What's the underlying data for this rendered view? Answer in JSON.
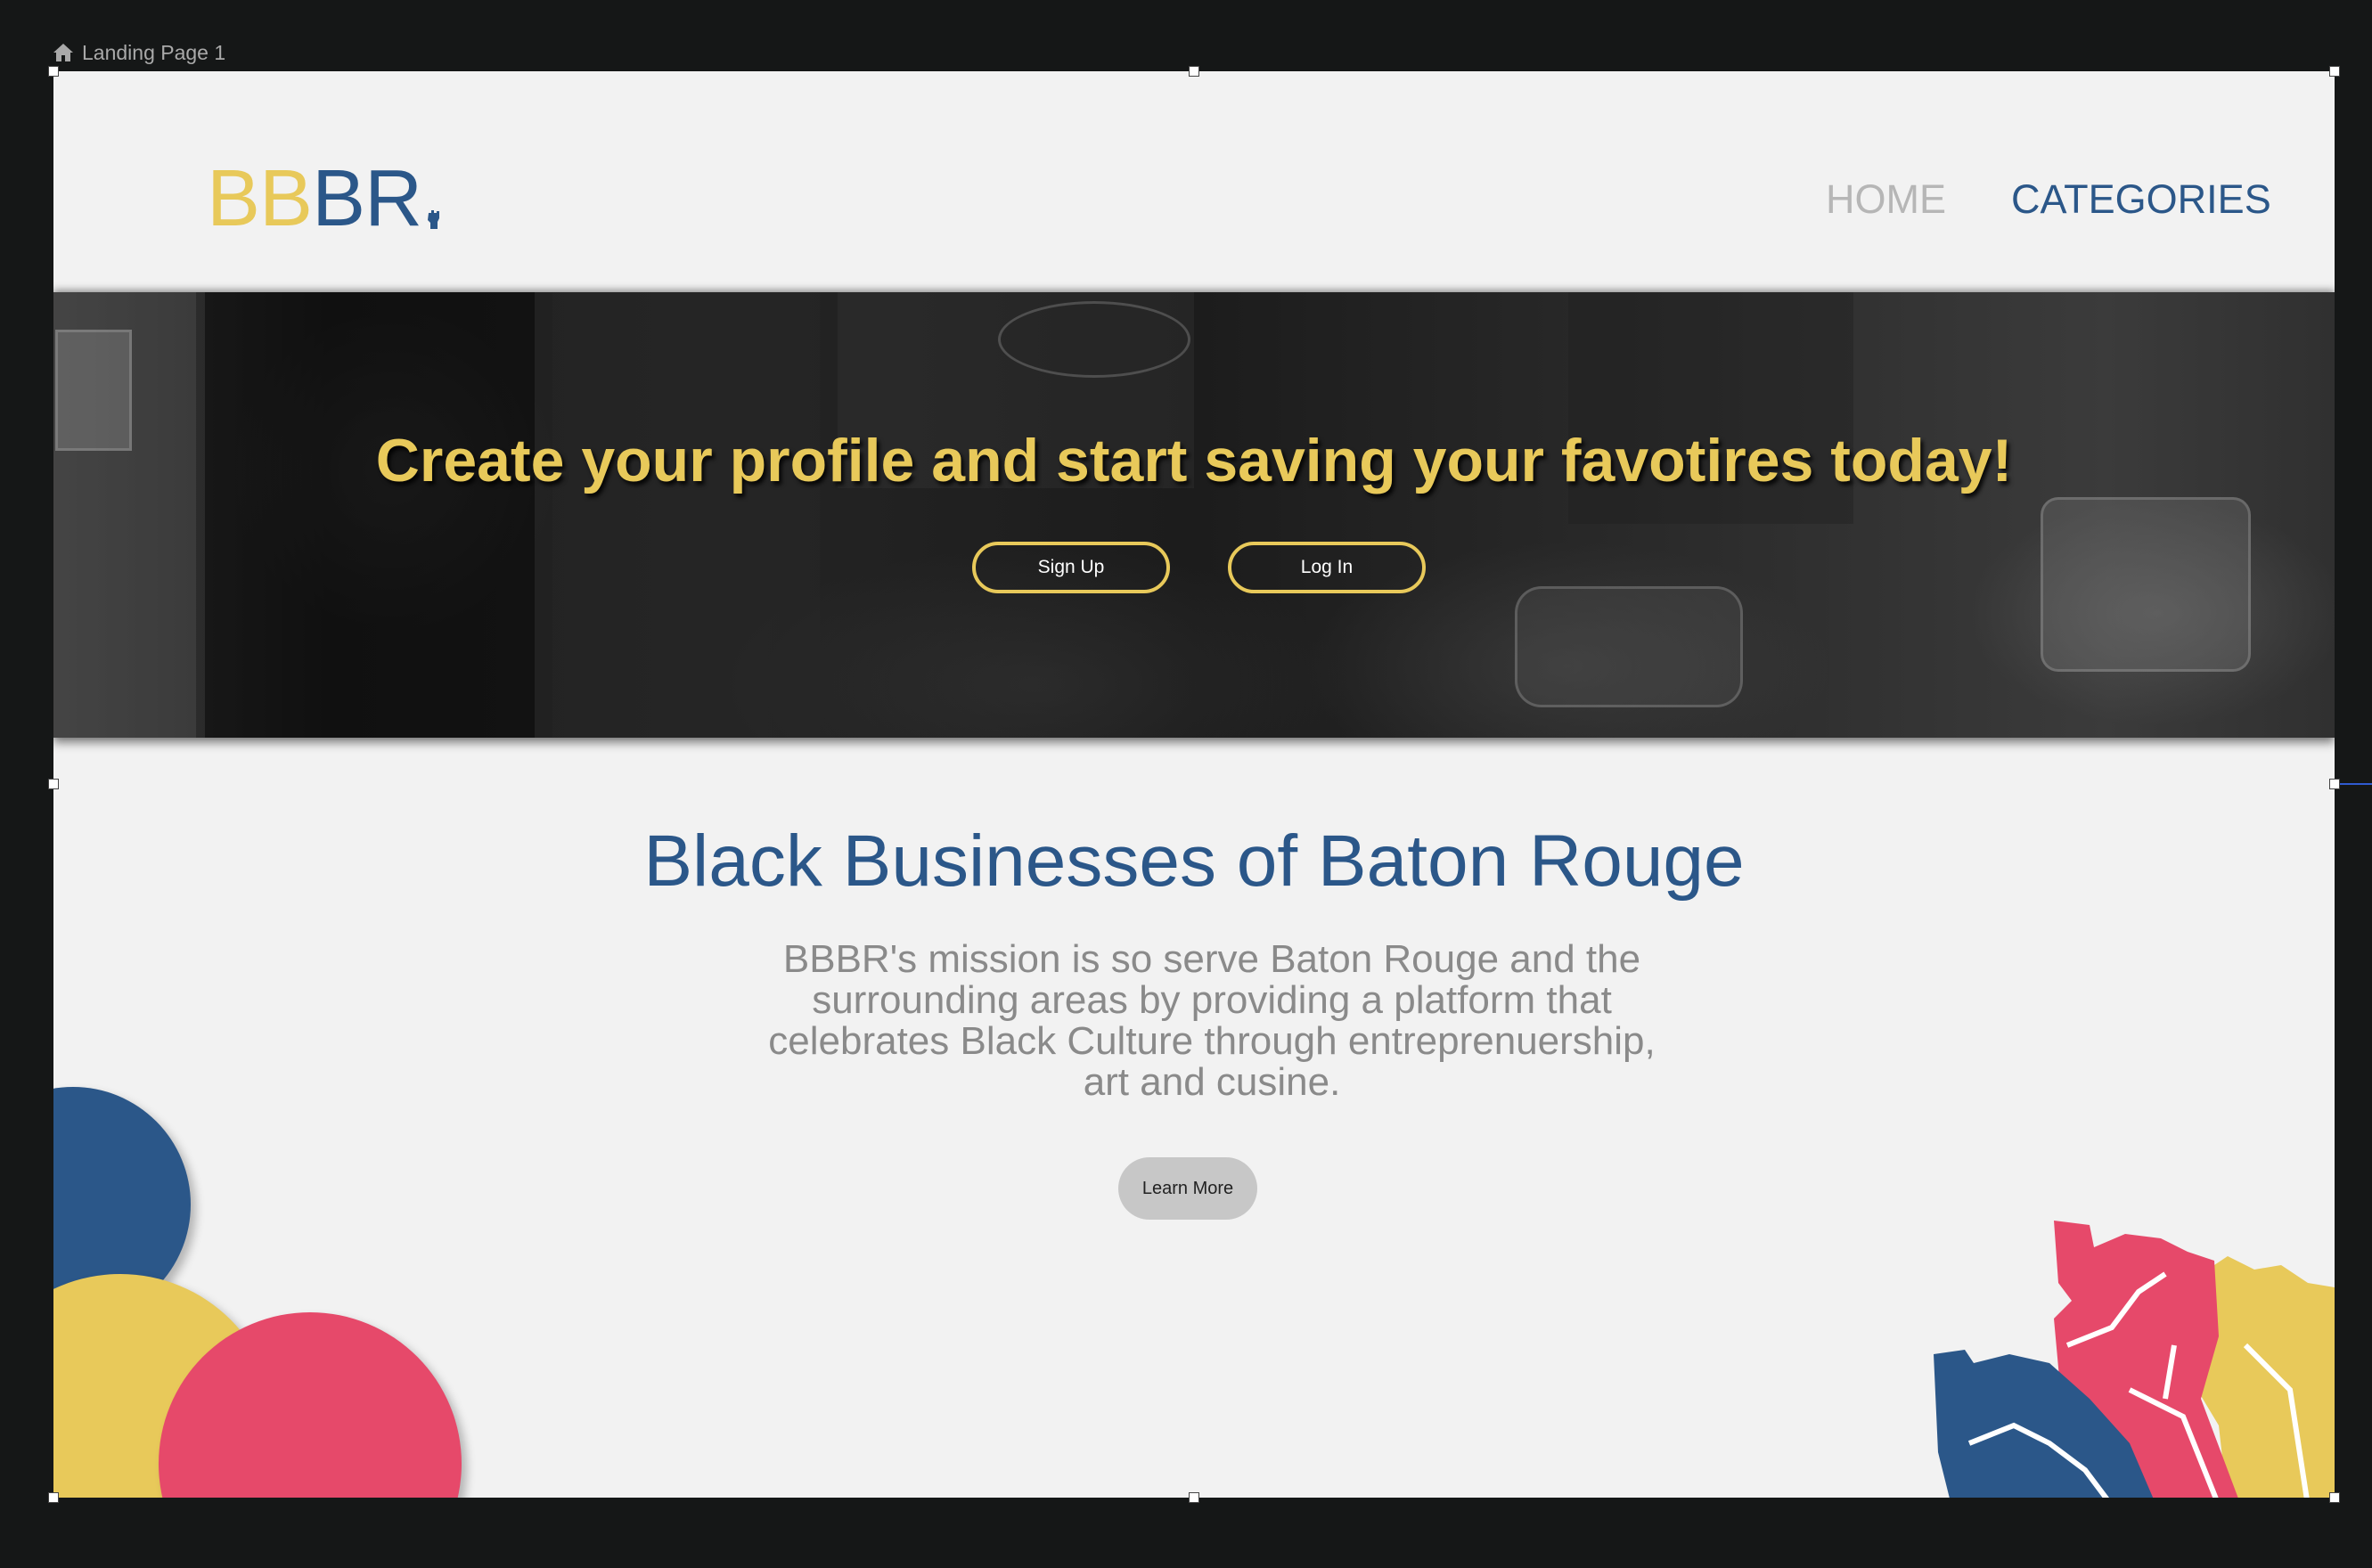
{
  "canvas": {
    "frame_label": "Landing Page 1"
  },
  "header": {
    "logo": {
      "part1": "BB",
      "part2": "BR"
    },
    "nav": {
      "home": "HOME",
      "categories": "CATEGORIES"
    }
  },
  "hero": {
    "headline": "Create your profile and start saving your favotires today!",
    "signup_label": "Sign Up",
    "login_label": "Log In"
  },
  "main": {
    "title": "Black Businesses of Baton Rouge",
    "mission": "BBBR's mission is so serve Baton Rouge and the surrounding areas by providing a platform that celebrates Black Culture through entreprenuership, art and cusine.",
    "learn_more_label": "Learn More"
  },
  "colors": {
    "brand_yellow": "#e8c95a",
    "brand_blue": "#2b5789",
    "brand_pink": "#e6496a",
    "page_bg": "#f2f2f2",
    "canvas_bg": "#151717"
  },
  "icons": {
    "frame": "home-icon",
    "logo_mark": "raised-fist-icon",
    "decoration": "raised-fists-illustration"
  }
}
